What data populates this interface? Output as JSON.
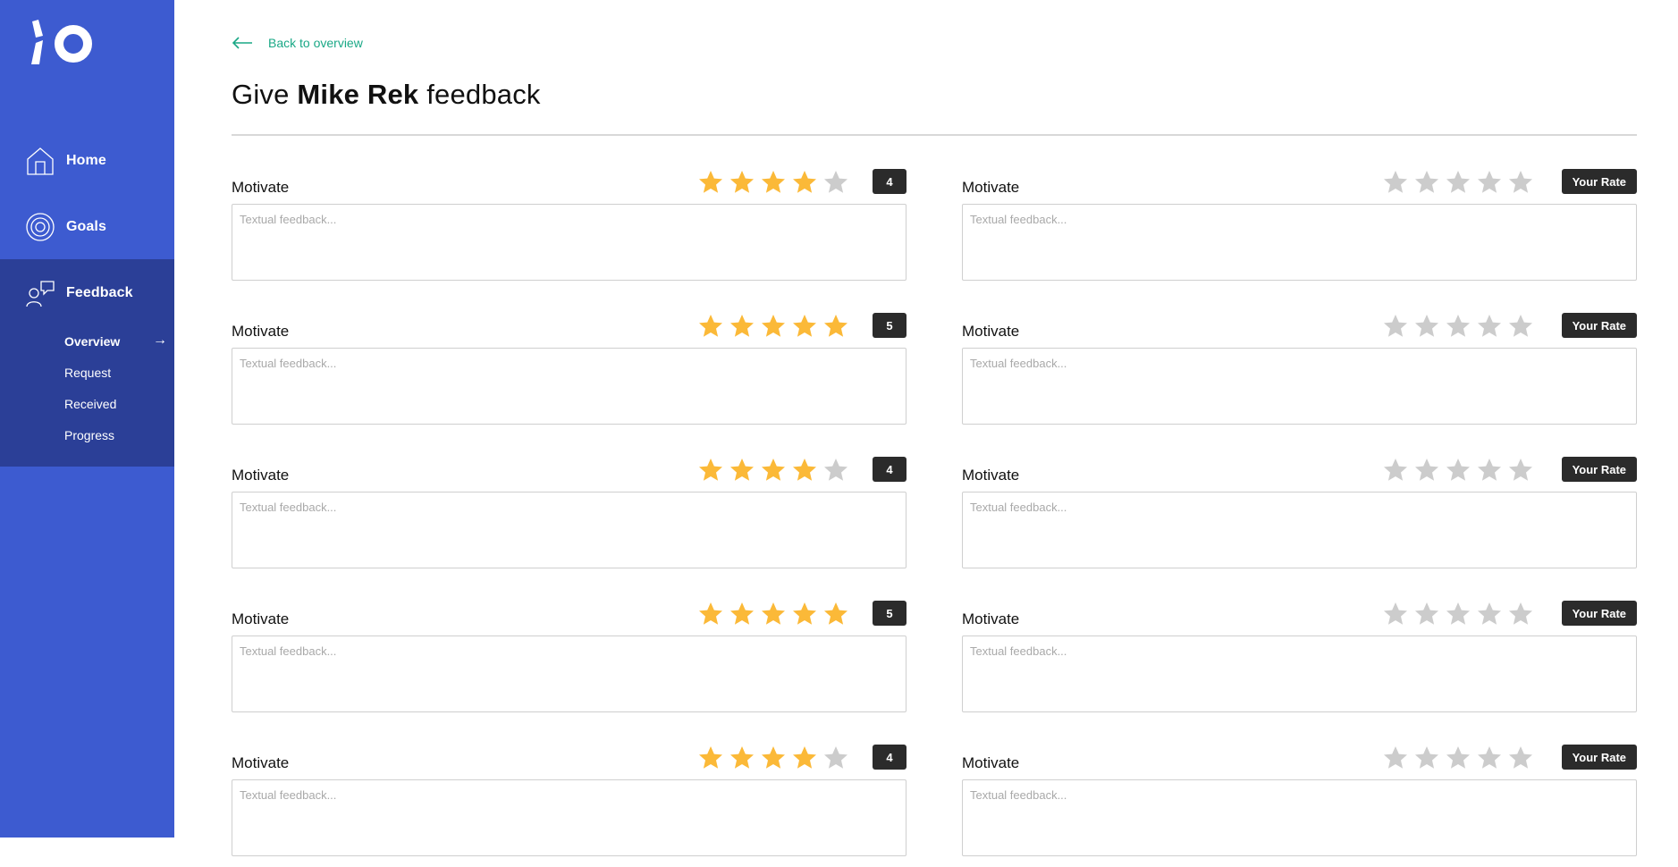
{
  "sidebar": {
    "nav": [
      {
        "label": "Home",
        "icon": "home-icon"
      },
      {
        "label": "Goals",
        "icon": "target-icon"
      },
      {
        "label": "Feedback",
        "icon": "feedback-icon"
      }
    ],
    "subnav": [
      {
        "label": "Overview",
        "active": true
      },
      {
        "label": "Request"
      },
      {
        "label": "Received"
      },
      {
        "label": "Progress"
      }
    ],
    "active_arrow": "→"
  },
  "header": {
    "back_label": "Back to overview",
    "title_prefix": "Give",
    "title_name": "Mike Rek",
    "title_suffix": "feedback"
  },
  "colors": {
    "sidebar_bg": "#3d5bd0",
    "sidebar_active_bg": "#2b3f97",
    "accent_green": "#1aa886",
    "star_filled": "#fbb938",
    "star_empty": "#cccccc",
    "badge_bg": "#2b2b2b"
  },
  "feedback_rows": [
    {
      "left": {
        "label": "Motivate",
        "rating": 4,
        "badge": "4",
        "placeholder": "Textual feedback..."
      },
      "right": {
        "label": "Motivate",
        "rating": 0,
        "badge": "Your Rate",
        "placeholder": "Textual feedback..."
      }
    },
    {
      "left": {
        "label": "Motivate",
        "rating": 5,
        "badge": "5",
        "placeholder": "Textual feedback..."
      },
      "right": {
        "label": "Motivate",
        "rating": 0,
        "badge": "Your Rate",
        "placeholder": "Textual feedback..."
      }
    },
    {
      "left": {
        "label": "Motivate",
        "rating": 4,
        "badge": "4",
        "placeholder": "Textual feedback..."
      },
      "right": {
        "label": "Motivate",
        "rating": 0,
        "badge": "Your Rate",
        "placeholder": "Textual feedback..."
      }
    },
    {
      "left": {
        "label": "Motivate",
        "rating": 5,
        "badge": "5",
        "placeholder": "Textual feedback..."
      },
      "right": {
        "label": "Motivate",
        "rating": 0,
        "badge": "Your Rate",
        "placeholder": "Textual feedback..."
      }
    },
    {
      "left": {
        "label": "Motivate",
        "rating": 4,
        "badge": "4",
        "placeholder": "Textual feedback..."
      },
      "right": {
        "label": "Motivate",
        "rating": 0,
        "badge": "Your Rate",
        "placeholder": "Textual feedback..."
      }
    }
  ]
}
